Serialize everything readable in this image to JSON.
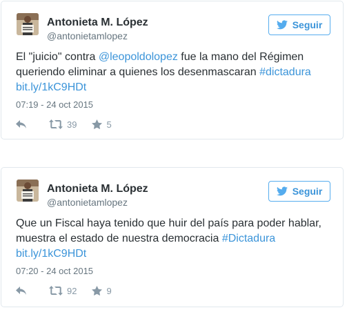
{
  "tweets": [
    {
      "name": "Antonieta M. López",
      "handle": "@antonietamlopez",
      "follow_label": "Seguir",
      "text": {
        "p1": "El \"juicio\" contra ",
        "mention": "@leopoldolopez",
        "p2": " fue la mano del Régimen queriendo eliminar a quienes los desenmascaran ",
        "hashtag": "#dictadura",
        "link": "bit.ly/1kC9HDt"
      },
      "time": "07:19 - 24 oct 2015",
      "retweets": "39",
      "likes": "5"
    },
    {
      "name": "Antonieta M. López",
      "handle": "@antonietamlopez",
      "follow_label": "Seguir",
      "text": {
        "p1": "Que un Fiscal haya tenido que huir del país para poder hablar, muestra el estado de nuestra democracia ",
        "hashtag": "#Dictadura",
        "link": "bit.ly/1kC9HDt"
      },
      "time": "07:20 - 24 oct 2015",
      "retweets": "92",
      "likes": "9"
    }
  ],
  "colors": {
    "link": "#3b94d9",
    "text": "#292f33",
    "muted": "#66757f",
    "border": "#e1e8ed"
  },
  "icons": {
    "follow": "twitter-bird-icon",
    "reply": "reply-icon",
    "retweet": "retweet-icon",
    "like": "star-icon"
  }
}
